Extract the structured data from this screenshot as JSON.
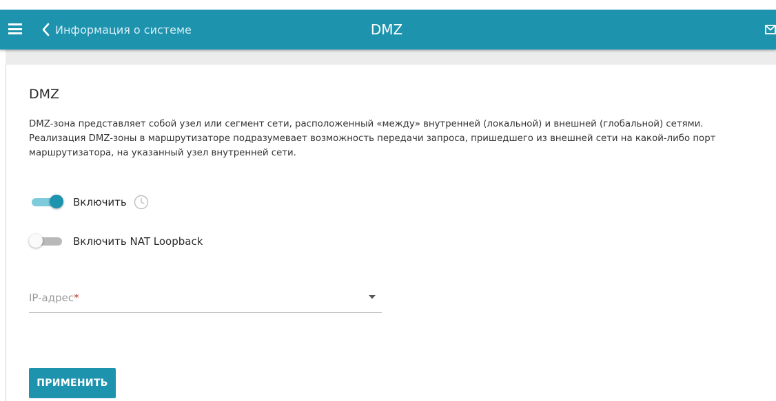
{
  "header": {
    "back_label": "Информация о системе",
    "title": "DMZ",
    "menu_icon": "hamburger-menu-icon",
    "back_icon": "chevron-left-icon",
    "mail_icon": "envelope-icon",
    "color": "#1e93ae"
  },
  "section": {
    "heading": "DMZ",
    "description": "DMZ-зона представляет собой узел или сегмент сети, расположенный «между» внутренней (локальной) и внешней (глобальной) сетями. Реализация DMZ-зоны в маршрутизаторе подразумевает возможность передачи запроса, пришедшего из внешней сети на какой-либо порт маршрутизатора, на указанный узел внутренней сети."
  },
  "toggles": [
    {
      "label": "Включить",
      "checked": true,
      "icon": "clock-icon"
    },
    {
      "label": "Включить NAT Loopback",
      "checked": false
    }
  ],
  "ip_field": {
    "label": "IP-адрес",
    "required_mark": "*",
    "value": ""
  },
  "apply_label": "ПРИМЕНИТЬ"
}
